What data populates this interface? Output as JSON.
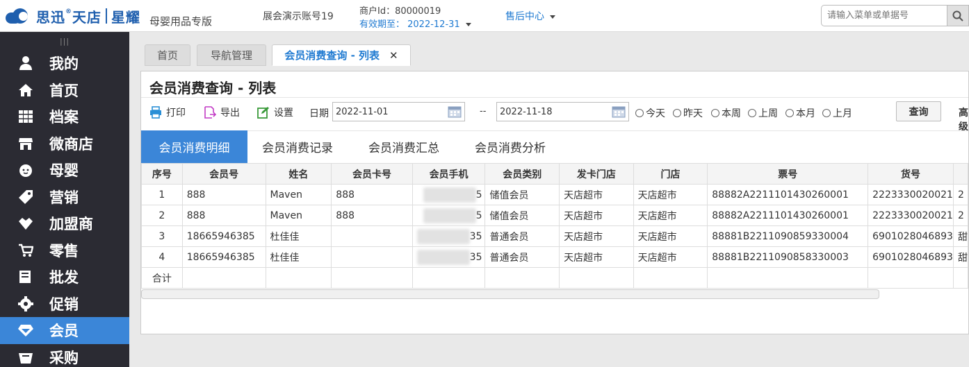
{
  "header": {
    "logo_brand": "思迅",
    "logo_product": "天店",
    "logo_sub": "星耀",
    "edition": "母婴用品专版",
    "account": "展会演示账号19",
    "merchant_id": "商户Id：80000019",
    "expiry": "有效期至： 2022-12-31",
    "service": "售后中心",
    "search_placeholder": "请输入菜单或单据号"
  },
  "sidebar": {
    "items": [
      {
        "label": "我的",
        "icon": "user-icon"
      },
      {
        "label": "首页",
        "icon": "home-icon"
      },
      {
        "label": "档案",
        "icon": "grid-icon"
      },
      {
        "label": "微商店",
        "icon": "shop-icon"
      },
      {
        "label": "母婴",
        "icon": "baby-icon"
      },
      {
        "label": "营销",
        "icon": "tag-icon"
      },
      {
        "label": "加盟商",
        "icon": "handshake-icon"
      },
      {
        "label": "零售",
        "icon": "cart-icon"
      },
      {
        "label": "批发",
        "icon": "box-icon"
      },
      {
        "label": "促销",
        "icon": "gear-icon"
      },
      {
        "label": "会员",
        "icon": "diamond-icon"
      },
      {
        "label": "采购",
        "icon": "basket-icon"
      }
    ],
    "active_index": 10
  },
  "tabs": [
    {
      "label": "首页"
    },
    {
      "label": "导航管理"
    },
    {
      "label": "会员消费查询 - 列表"
    }
  ],
  "page": {
    "title": "会员消费查询 - 列表",
    "toolbar": {
      "print": "打印",
      "export": "导出",
      "settings": "设置",
      "date_label": "日期",
      "date_from": "2022-11-01",
      "date_sep": "--",
      "date_to": "2022-11-18",
      "ranges": [
        "今天",
        "昨天",
        "本周",
        "上周",
        "本月",
        "上月"
      ],
      "query": "查询",
      "advanced": "高级"
    },
    "subtabs": [
      "会员消费明细",
      "会员消费记录",
      "会员消费汇总",
      "会员消费分析"
    ],
    "table": {
      "columns": [
        "序号",
        "会员号",
        "姓名",
        "会员卡号",
        "会员手机",
        "会员类别",
        "发卡门店",
        "门店",
        "票号",
        "货号",
        ""
      ],
      "rows": [
        {
          "no": "1",
          "member_no": "888",
          "name": "Maven",
          "card": "888",
          "phone_tail": "5",
          "category": "储值会员",
          "issue_store": "天店超市",
          "store": "天店超市",
          "ticket": "88882A2211101430260001",
          "sku": "2223330020021",
          "extra": "2"
        },
        {
          "no": "2",
          "member_no": "888",
          "name": "Maven",
          "card": "888",
          "phone_tail": "5",
          "category": "储值会员",
          "issue_store": "天店超市",
          "store": "天店超市",
          "ticket": "88882A2211101430260001",
          "sku": "2223330020021",
          "extra": "2"
        },
        {
          "no": "3",
          "member_no": "18665946385",
          "name": "杜佳佳",
          "card": "",
          "phone_tail": "35",
          "category": "普通会员",
          "issue_store": "天店超市",
          "store": "天店超市",
          "ticket": "88881B2211090859330004",
          "sku": "6901028046893",
          "extra": "甜"
        },
        {
          "no": "4",
          "member_no": "18665946385",
          "name": "杜佳佳",
          "card": "",
          "phone_tail": "35",
          "category": "普通会员",
          "issue_store": "天店超市",
          "store": "天店超市",
          "ticket": "88881B2211090858330003",
          "sku": "6901028046893",
          "extra": "甜"
        }
      ],
      "total_label": "合计"
    }
  },
  "colors": {
    "accent": "#3b86d8",
    "sidebar_bg": "#2b2b33",
    "brand": "#1f5fae",
    "link": "#1f7ad1"
  }
}
